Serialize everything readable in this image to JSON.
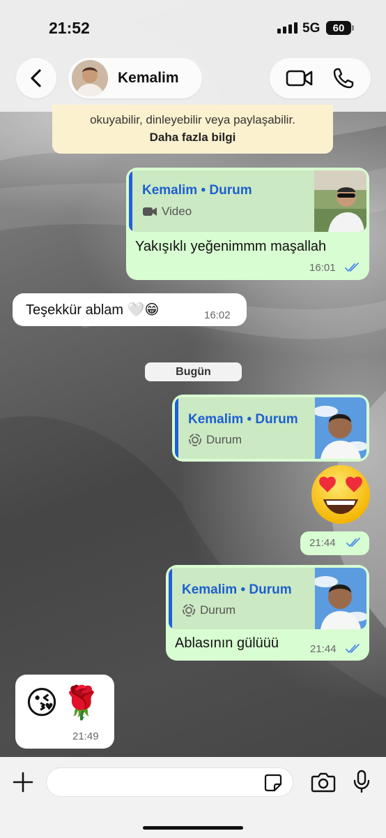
{
  "status_bar": {
    "time": "21:52",
    "network": "5G",
    "battery": "60"
  },
  "header": {
    "contact_name": "Kemalim"
  },
  "notice": {
    "text": "okuyabilir, dinleyebilir veya paylaşabilir.",
    "link": "Daha fazla bilgi"
  },
  "messages": [
    {
      "direction": "out",
      "reply_title": "Kemalim • Durum",
      "reply_type": "Video",
      "reply_icon": "video-icon",
      "text": "Yakışıklı yeğenimmm maşallah",
      "time": "16:01",
      "read": true
    },
    {
      "direction": "in",
      "text": "Teşekkür ablam 🤍😁",
      "time": "16:02"
    },
    {
      "date_separator": "Bugün"
    },
    {
      "direction": "out",
      "reply_title": "Kemalim • Durum",
      "reply_type": "Durum",
      "reply_icon": "status-icon",
      "emoji": "😍",
      "time": "21:44",
      "read": true
    },
    {
      "direction": "out",
      "reply_title": "Kemalim • Durum",
      "reply_type": "Durum",
      "reply_icon": "status-icon",
      "text": "Ablasının gülüüü",
      "time": "21:44",
      "read": true
    },
    {
      "direction": "in",
      "text": "😘🌹",
      "time": "21:49"
    }
  ],
  "composer": {
    "placeholder": ""
  },
  "colors": {
    "outgoing_bubble": "#d8fdd2",
    "incoming_bubble": "#ffffff",
    "reply_accent": "#1e60d8",
    "read_ticks": "#4a8be8",
    "notice_bg": "#fcf1cf"
  }
}
